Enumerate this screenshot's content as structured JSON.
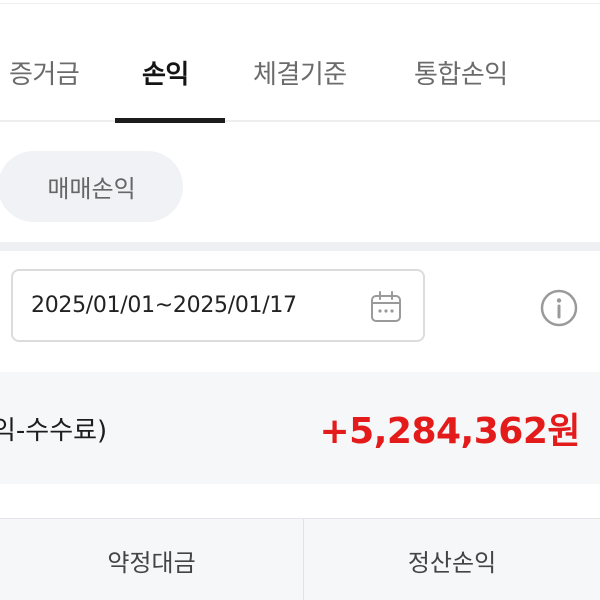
{
  "tabs": [
    {
      "label": "증거금",
      "active": false
    },
    {
      "label": "손익",
      "active": true
    },
    {
      "label": "체결기준",
      "active": false
    },
    {
      "label": "통합손익",
      "active": false
    }
  ],
  "filter_chip": {
    "label": "매매손익"
  },
  "date_range": {
    "value": "2025/01/01~2025/01/17"
  },
  "icons": {
    "calendar": "calendar-icon",
    "info": "info-circle-icon"
  },
  "summary": {
    "label": "익-수수료)",
    "value": "+5,284,362원",
    "value_color": "#e31b1b"
  },
  "table": {
    "columns": [
      "약정대금",
      "정산손익"
    ]
  }
}
